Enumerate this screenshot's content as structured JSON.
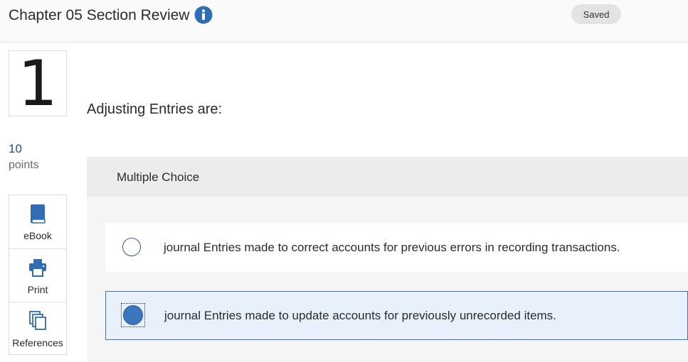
{
  "header": {
    "title": "Chapter 05 Section Review",
    "info_icon": "info-circle-icon",
    "status_badge": "Saved"
  },
  "question": {
    "number": "1",
    "points_value": "10",
    "points_label": "points",
    "text": "Adjusting Entries are:",
    "type_label": "Multiple Choice"
  },
  "tools": [
    {
      "label": "eBook",
      "icon": "book-icon"
    },
    {
      "label": "Print",
      "icon": "printer-icon"
    },
    {
      "label": "References",
      "icon": "documents-icon"
    }
  ],
  "options": [
    {
      "text": "journal Entries made to correct accounts for previous errors in recording transactions.",
      "selected": false
    },
    {
      "text": "journal Entries made to update accounts for previously unrecorded items.",
      "selected": true
    }
  ],
  "colors": {
    "accent": "#3b75bf",
    "selected_bg": "#e8f1fb",
    "points": "#1f4e8c"
  }
}
